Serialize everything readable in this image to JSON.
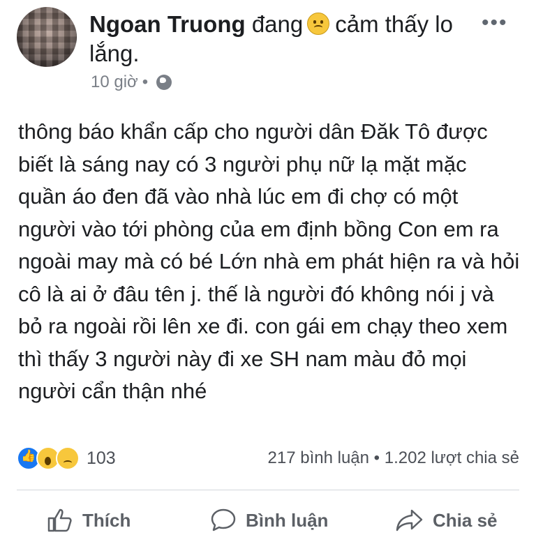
{
  "post": {
    "author": "Ngoan Truong",
    "feeling_prefix": "đang",
    "feeling_text": "cảm thấy lo lắng.",
    "time": "10 giờ",
    "separator": "•",
    "privacy_icon": "globe-icon",
    "body": "thông báo khẩn cấp cho người dân Đăk Tô được biết là sáng nay có 3 người phụ nữ lạ mặt mặc quần áo đen đã vào nhà lúc em đi chợ có một người vào tới phòng của em định bồng Con em ra ngoài may mà có bé Lớn nhà em phát hiện ra và hỏi cô là ai ở đâu tên j. thế là người đó không nói j và bỏ ra ngoài rồi lên xe đi. con gái em chạy theo xem thì thấy 3 người này đi xe SH nam màu đỏ mọi người cẩn thận nhé"
  },
  "menu": {
    "more_label": "•••"
  },
  "engagement": {
    "reactions": [
      "like",
      "wow",
      "sad"
    ],
    "reaction_count": "103",
    "comments": "217 bình luận",
    "dot": "•",
    "shares": "1.202 lượt chia sẻ"
  },
  "actions": {
    "like": "Thích",
    "comment": "Bình luận",
    "share": "Chia sẻ"
  },
  "colors": {
    "like_blue": "#1877f2",
    "emoji_yellow": "#f7c73c",
    "muted_gray": "#7a7f87"
  }
}
